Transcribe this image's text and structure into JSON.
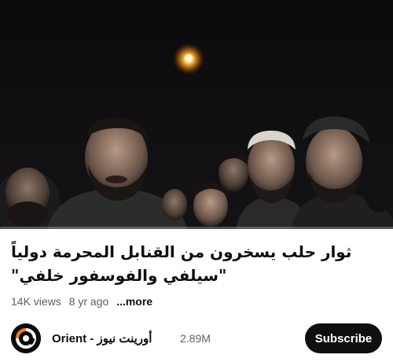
{
  "video": {
    "progress_fraction": 0.0
  },
  "info": {
    "title": "ثوار حلب يسخرون من القنابل المحرمة دولياً \"سيلفي والفوسفور خلفي\"",
    "views": "14K views",
    "age": "8 yr ago",
    "more_label": "...more"
  },
  "channel": {
    "name": "Orient - أورينت نيوز",
    "subscribers": "2.89M",
    "avatar_icon": "orient-logo-icon",
    "subscribe_label": "Subscribe"
  },
  "colors": {
    "subscribe_bg": "#0f0f0f",
    "progress": "#ff0000",
    "meta_text": "#606060"
  }
}
